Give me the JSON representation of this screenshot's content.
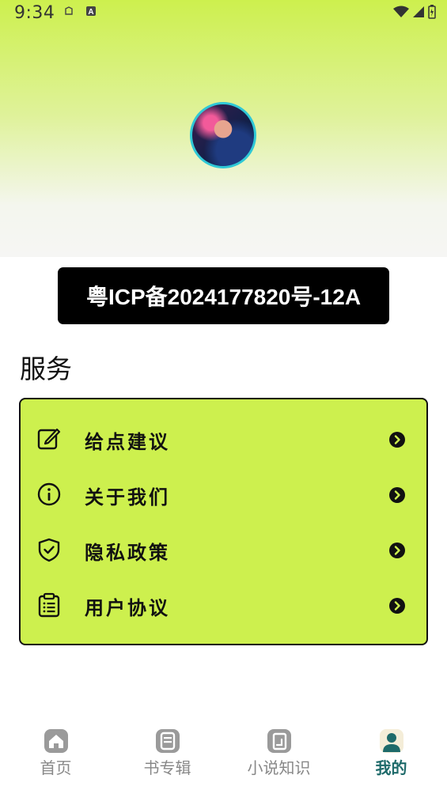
{
  "status_bar": {
    "time": "9:34"
  },
  "header": {
    "avatar_alt": "用户头像"
  },
  "icp": {
    "text": "粤ICP备2024177820号-12A"
  },
  "services": {
    "title": "服务",
    "items": [
      {
        "label": "给点建议",
        "icon": "edit-icon"
      },
      {
        "label": "关于我们",
        "icon": "info-icon"
      },
      {
        "label": "隐私政策",
        "icon": "shield-icon"
      },
      {
        "label": "用户协议",
        "icon": "clipboard-icon"
      }
    ]
  },
  "tabbar": {
    "tabs": [
      {
        "label": "首页",
        "icon": "home-icon",
        "active": false
      },
      {
        "label": "书专辑",
        "icon": "book-icon",
        "active": false
      },
      {
        "label": "小说知识",
        "icon": "notes-icon",
        "active": false
      },
      {
        "label": "我的",
        "icon": "user-icon",
        "active": true
      }
    ]
  },
  "colors": {
    "accent": "#cdf04e",
    "active_tab": "#1e6a6a",
    "inactive_tab": "#888888",
    "avatar_border": "#2fc8d6"
  }
}
